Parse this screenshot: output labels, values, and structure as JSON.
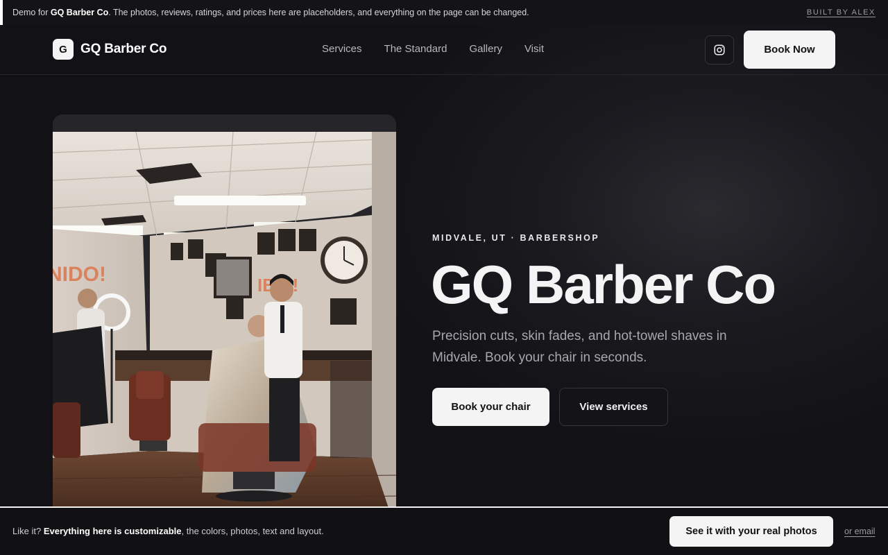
{
  "banner": {
    "prefix": "Demo for ",
    "brand": "GQ Barber Co",
    "suffix": ". The photos, reviews, ratings, and prices here are placeholders, and everything on the page can be changed.",
    "built_by": "BUILT BY ALEX"
  },
  "nav": {
    "logo_letter": "G",
    "brand": "GQ Barber Co",
    "links": [
      "Services",
      "The Standard",
      "Gallery",
      "Visit"
    ],
    "instagram_icon": "instagram-icon",
    "book_now": "Book Now"
  },
  "hero": {
    "eyebrow": "MIDVALE, UT · BARBERSHOP",
    "title": "GQ Barber Co",
    "subtitle": "Precision cuts, skin fades, and hot-towel shaves in Midvale. Book your chair in seconds.",
    "primary_button": "Book your chair",
    "secondary_button": "View services",
    "photo_wall_text_1": "NIDO!",
    "photo_wall_text_2": "IBIE!"
  },
  "bottom_bar": {
    "prefix": "Like it? ",
    "strong": "Everything here is customizable",
    "suffix": ", the colors, photos, text and layout.",
    "cta": "See it with your real photos",
    "email_link": "or email"
  },
  "colors": {
    "background": "#121216",
    "accent": "#f4f4f4",
    "muted_text": "#a7a7ad"
  }
}
